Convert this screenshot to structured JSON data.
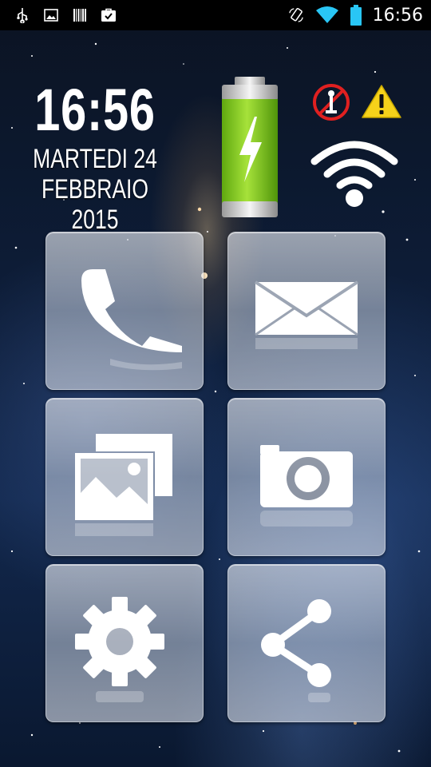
{
  "status_bar": {
    "left_icons": [
      "usb-icon",
      "image-notification-icon",
      "barcode-icon",
      "briefcase-check-icon"
    ],
    "right_icons": [
      "screen-rotation-icon",
      "wifi-signal-icon",
      "battery-full-icon"
    ],
    "time": "16:56"
  },
  "clock": {
    "time": "16:56",
    "date_line1": "MARTEDI 24",
    "date_line2": "FEBBRAIO 2015"
  },
  "widgets": {
    "battery_icon": "battery-charging-icon",
    "battery_color": "#8fd11e",
    "alert_icons": [
      "no-signal-icon",
      "warning-icon"
    ],
    "wifi_icon": "wifi-large-icon"
  },
  "tiles": [
    {
      "name": "phone-tile",
      "icon": "phone-icon"
    },
    {
      "name": "messages-tile",
      "icon": "envelope-icon"
    },
    {
      "name": "gallery-tile",
      "icon": "gallery-icon"
    },
    {
      "name": "camera-tile",
      "icon": "camera-icon"
    },
    {
      "name": "settings-tile",
      "icon": "gear-icon"
    },
    {
      "name": "share-tile",
      "icon": "share-icon"
    }
  ],
  "colors": {
    "status_bar_bg": "#000000",
    "accent_cyan": "#29c6f5",
    "warning_yellow": "#f6d21a",
    "no_signal_red": "#e02020"
  }
}
